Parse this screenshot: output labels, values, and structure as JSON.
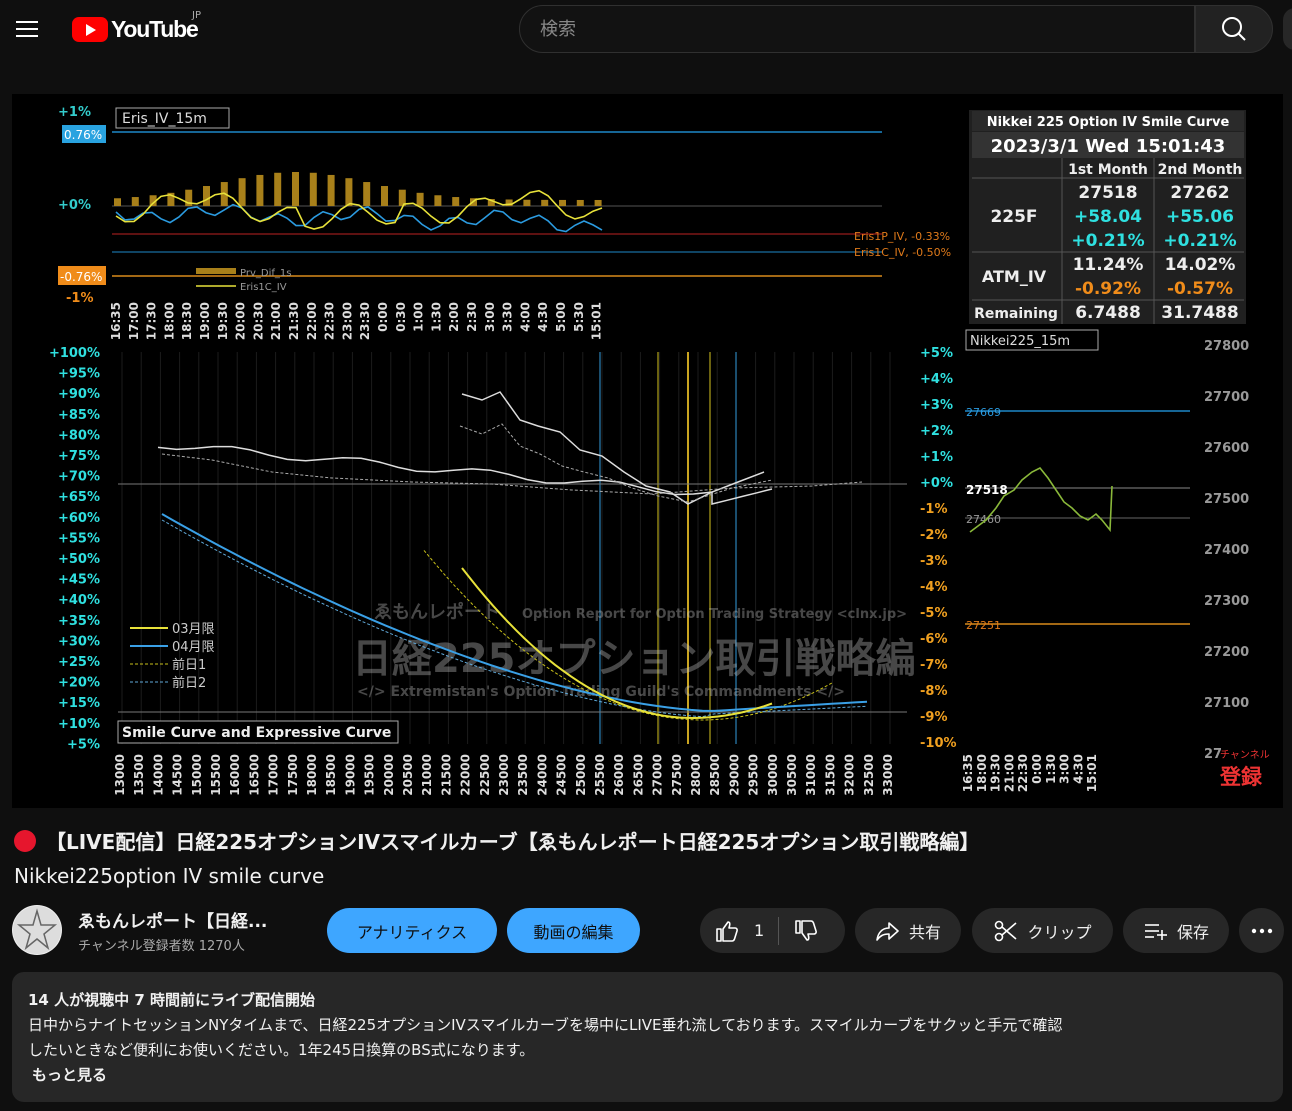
{
  "header": {
    "logo_text": "YouTube",
    "region": "JP",
    "search_placeholder": "検索"
  },
  "video": {
    "chart_header": "Nikkei 225 Option IV Smile Curve",
    "datetime": "2023/3/1 Wed 15:01:43",
    "col1": "1st Month",
    "col2": "2nd Month",
    "f_label": "225F",
    "f1": "27518",
    "f2": "27262",
    "f1_chg": "+58.04",
    "f2_chg": "+55.06",
    "f1_pct": "+0.21%",
    "f2_pct": "+0.21%",
    "atm_label": "ATM_IV",
    "atm1": "11.24%",
    "atm2": "14.02%",
    "atm1_chg": "-0.92%",
    "atm2_chg": "-0.57%",
    "remain_label": "Remaining",
    "remain1": "6.7488",
    "remain2": "31.7488",
    "eris_title": "Eris_IV_15m",
    "eris_p1": "+1%",
    "eris_box": "0.76%",
    "eris_0": "+0%",
    "eris_neg_box": "-0.76%",
    "eris_m1": "-1%",
    "eris_p_label": "Eris1P_IV, -0.33%",
    "eris_c_label": "Eris1C_IV, -0.50%",
    "eris_leg1": "Prv_Dif_1s",
    "eris_leg2": "Eris1C_IV",
    "eris_x": [
      "16:35",
      "17:00",
      "17:30",
      "18:00",
      "18:30",
      "19:00",
      "19:30",
      "20:00",
      "20:30",
      "21:00",
      "21:30",
      "22:00",
      "22:30",
      "23:00",
      "23:30",
      "0:00",
      "0:30",
      "1:00",
      "1:30",
      "2:00",
      "2:30",
      "3:00",
      "3:30",
      "4:00",
      "4:30",
      "5:00",
      "5:30",
      "15:01"
    ],
    "nk_title": "Nikkei225_15m",
    "nk_last": "27518",
    "nk_high": "27669",
    "nk_mid": "27460",
    "nk_low": "27251",
    "nk_y": [
      "27800",
      "27700",
      "27600",
      "27500",
      "27400",
      "27300",
      "27200",
      "27100",
      "27"
    ],
    "nk_x": [
      "16:35",
      "18:00",
      "19:30",
      "21:00",
      "22:30",
      "0:00",
      "1:30",
      "3:00",
      "4:30",
      "15:01"
    ],
    "smile_y": [
      "+100%",
      "+95%",
      "+90%",
      "+85%",
      "+80%",
      "+75%",
      "+70%",
      "+65%",
      "+60%",
      "+55%",
      "+50%",
      "+45%",
      "+40%",
      "+35%",
      "+30%",
      "+25%",
      "+20%",
      "+15%",
      "+10%",
      "+5%"
    ],
    "pct_y": [
      "+5%",
      "+4%",
      "+3%",
      "+2%",
      "+1%",
      "+0%",
      "-1%",
      "-2%",
      "-3%",
      "-4%",
      "-5%",
      "-6%",
      "-7%",
      "-8%",
      "-9%",
      "-10%"
    ],
    "strikes": [
      "13000",
      "13500",
      "14000",
      "14500",
      "15000",
      "15500",
      "16000",
      "16500",
      "17000",
      "17500",
      "18000",
      "18500",
      "19000",
      "19500",
      "20000",
      "20500",
      "21000",
      "21500",
      "22000",
      "22500",
      "23000",
      "23500",
      "24000",
      "24500",
      "25000",
      "25500",
      "26000",
      "26500",
      "27000",
      "27500",
      "28000",
      "28500",
      "29000",
      "29500",
      "30000",
      "30500",
      "31000",
      "31500",
      "32000",
      "32500",
      "33000"
    ],
    "legend": [
      "03月限",
      "04月限",
      "前日1",
      "前日2"
    ],
    "smile_title": "Smile Curve and Expressive Curve",
    "wm1": "ゑもんレポート",
    "wm1b": "Option Report for Option Trading Strategy <clnx.jp>",
    "wm2": "日経225オプション取引戦略編",
    "wm3": "</> Extremistan's Option Trading Guild's Commandments </>",
    "sub_small": "チャンネル",
    "sub_big": "登録"
  },
  "title": "【LIVE配信】日経225オプションIVスマイルカーブ【ゑもんレポート日経225オプション取引戦略編】",
  "subtitle": "Nikkei225option IV smile curve",
  "channel": {
    "name": "ゑもんレポート【日経...",
    "subs": "チャンネル登録者数 1270人"
  },
  "actions": {
    "analytics": "アナリティクス",
    "edit": "動画の編集",
    "likes": "1",
    "share": "共有",
    "clip": "クリップ",
    "save": "保存"
  },
  "description": {
    "meta": "14 人が視聴中  7 時間前にライブ配信開始",
    "line1": "日中からナイトセッションNYタイムまで、日経225オプションIVスマイルカーブを場中にLIVE垂れ流しております。スマイルカーブをサクッと手元で確認",
    "line2": "したいときなど便利にお使いください。1年245日換算のBS式になります。",
    "more": "もっと見る"
  }
}
